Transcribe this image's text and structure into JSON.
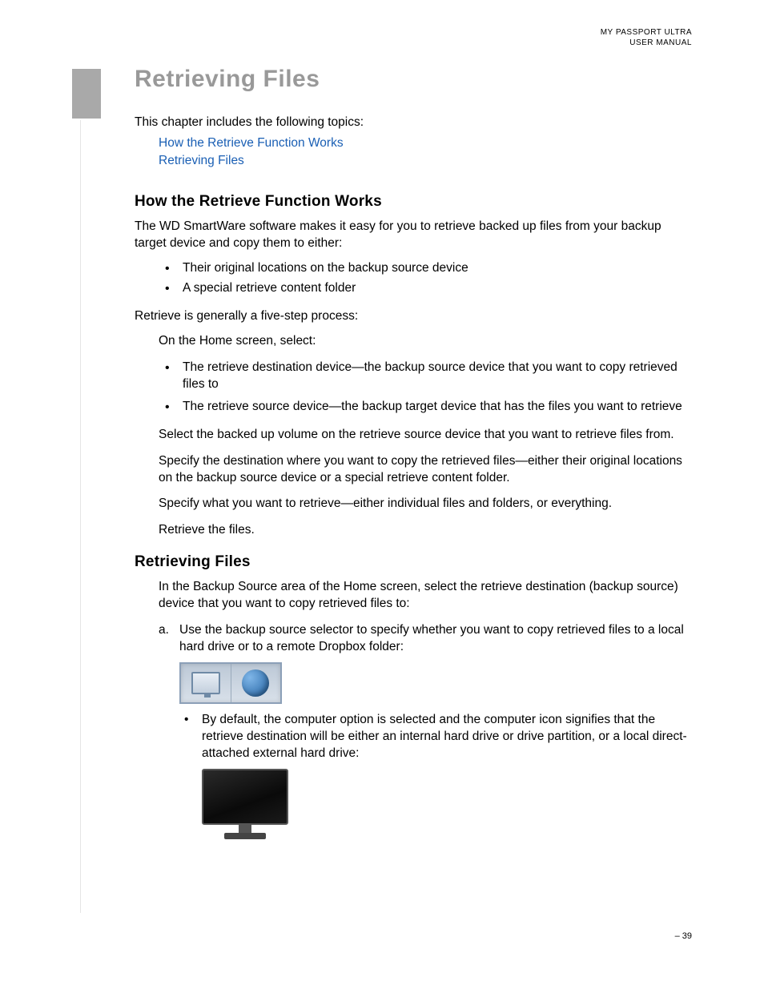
{
  "header": {
    "line1": "MY PASSPORT ULTRA",
    "line2": "USER MANUAL"
  },
  "chapter_title": "Retrieving Files",
  "intro": "This chapter includes the following topics:",
  "toc": {
    "link1": "How the Retrieve Function Works",
    "link2": "Retrieving Files"
  },
  "section1": {
    "heading": "How the Retrieve Function Works",
    "p1": "The WD SmartWare software makes it easy for you to retrieve backed up files from your backup target device and copy them to either:",
    "bullets1": {
      "b1": "Their original locations on the backup source device",
      "b2": "A special retrieve content folder"
    },
    "p2": "Retrieve is generally a five-step process:",
    "step_intro": "On the Home screen, select:",
    "bullets2": {
      "b1": "The retrieve destination device—the backup source device that you want to copy retrieved files to",
      "b2": "The retrieve source device—the backup target device that has the files you want to retrieve"
    },
    "step2": "Select the backed up volume on the retrieve source device that you want to retrieve files from.",
    "step3": "Specify the destination where you want to copy the retrieved files—either their original locations on the backup source device or a special retrieve content folder.",
    "step4": "Specify what you want to retrieve—either individual files and folders, or everything.",
    "step5": "Retrieve the files."
  },
  "section2": {
    "heading": "Retrieving Files",
    "p1": "In the Backup Source area of the Home screen, select the retrieve destination (backup source) device that you want to copy retrieved files to:",
    "a_marker": "a.",
    "a_text": "Use the backup source selector to specify whether you want to copy retrieved files to a local hard drive or to a remote Dropbox folder:",
    "sub_bullet": "By default, the computer option is selected and the computer icon signifies that the retrieve destination will be either an internal hard drive or drive partition, or a local direct-attached external hard drive:"
  },
  "page_number": "– 39"
}
